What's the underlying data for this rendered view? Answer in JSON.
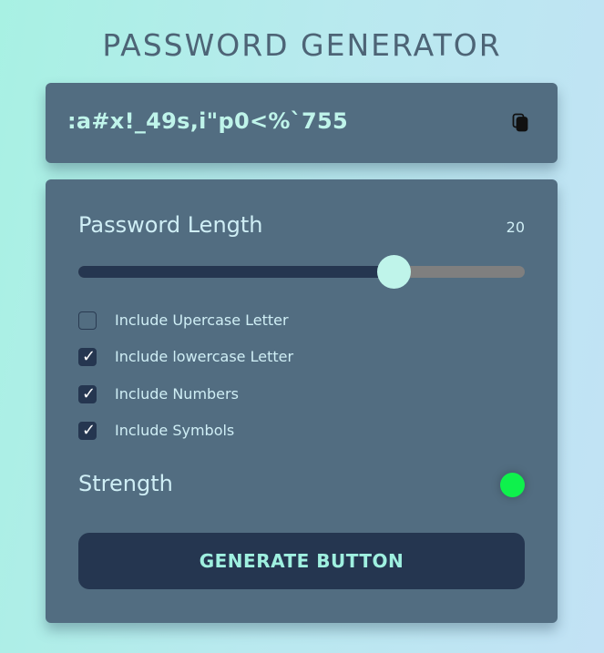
{
  "app": {
    "title": "PASSWORD GENERATOR"
  },
  "display": {
    "password": ":a#x!_49s,i\"p0<%`755",
    "copy_icon": "copy-icon"
  },
  "length": {
    "label": "Password Length",
    "value": "20",
    "slider_fraction": 0.707
  },
  "options": [
    {
      "label": "Include Upercase Letter",
      "checked": false
    },
    {
      "label": "Include lowercase Letter",
      "checked": true
    },
    {
      "label": "Include Numbers",
      "checked": true
    },
    {
      "label": "Include Symbols",
      "checked": true
    }
  ],
  "strength": {
    "label": "Strength",
    "indicator_color": "#0ef14c"
  },
  "actions": {
    "generate_label": "GENERATE BUTTON"
  },
  "colors": {
    "card": "#526d81",
    "accent": "#bff4ea",
    "dark": "#253650"
  }
}
